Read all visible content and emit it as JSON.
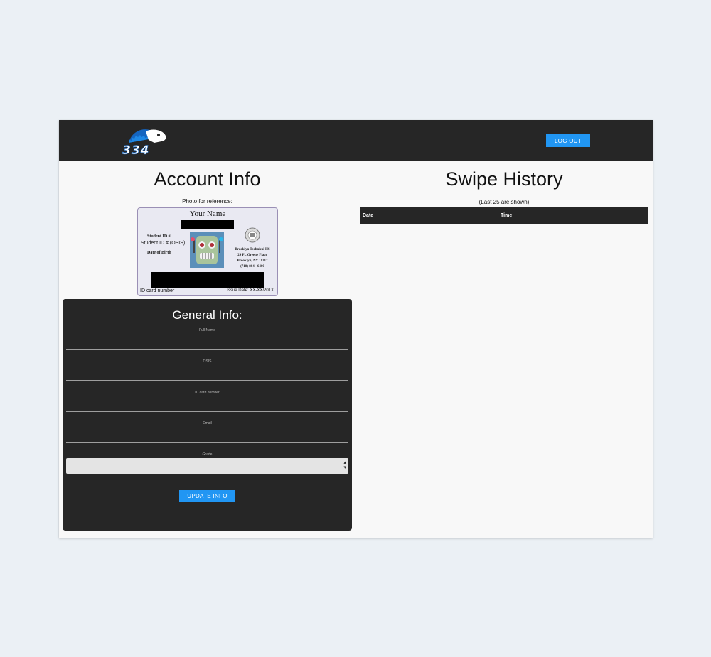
{
  "header": {
    "logo_text": "334",
    "logout_label": "LOG OUT"
  },
  "account": {
    "title": "Account Info",
    "photo_label": "Photo for reference:",
    "id_card": {
      "name": "Your Name",
      "student_id_label": "Student ID #",
      "osis_label": "Student ID # (OSIS)",
      "dob_label": "Date of Birth",
      "school_lines": [
        "Brooklyn Technical HS",
        "29 Ft. Greene Place",
        "Brooklyn, NY 11217",
        "(718) 804 - 6400"
      ],
      "card_number_label": "ID card number",
      "issue_date": "Issue Date: XX-XX/201X"
    }
  },
  "general_info": {
    "title": "General Info:",
    "fields": [
      {
        "label": "Full Name",
        "value": ""
      },
      {
        "label": "OSIS",
        "value": ""
      },
      {
        "label": "ID card number",
        "value": ""
      },
      {
        "label": "Email",
        "value": ""
      }
    ],
    "grade_label": "Grade",
    "grade_value": "",
    "update_label": "UPDATE INFO"
  },
  "swipe_history": {
    "title": "Swipe History",
    "note": "(Last 25 are shown)",
    "columns": [
      "Date",
      "Time"
    ],
    "rows": []
  },
  "colors": {
    "page_bg": "#ebf0f5",
    "dark": "#262626",
    "accent": "#2196f3",
    "logo_blue": "#1565c0"
  }
}
